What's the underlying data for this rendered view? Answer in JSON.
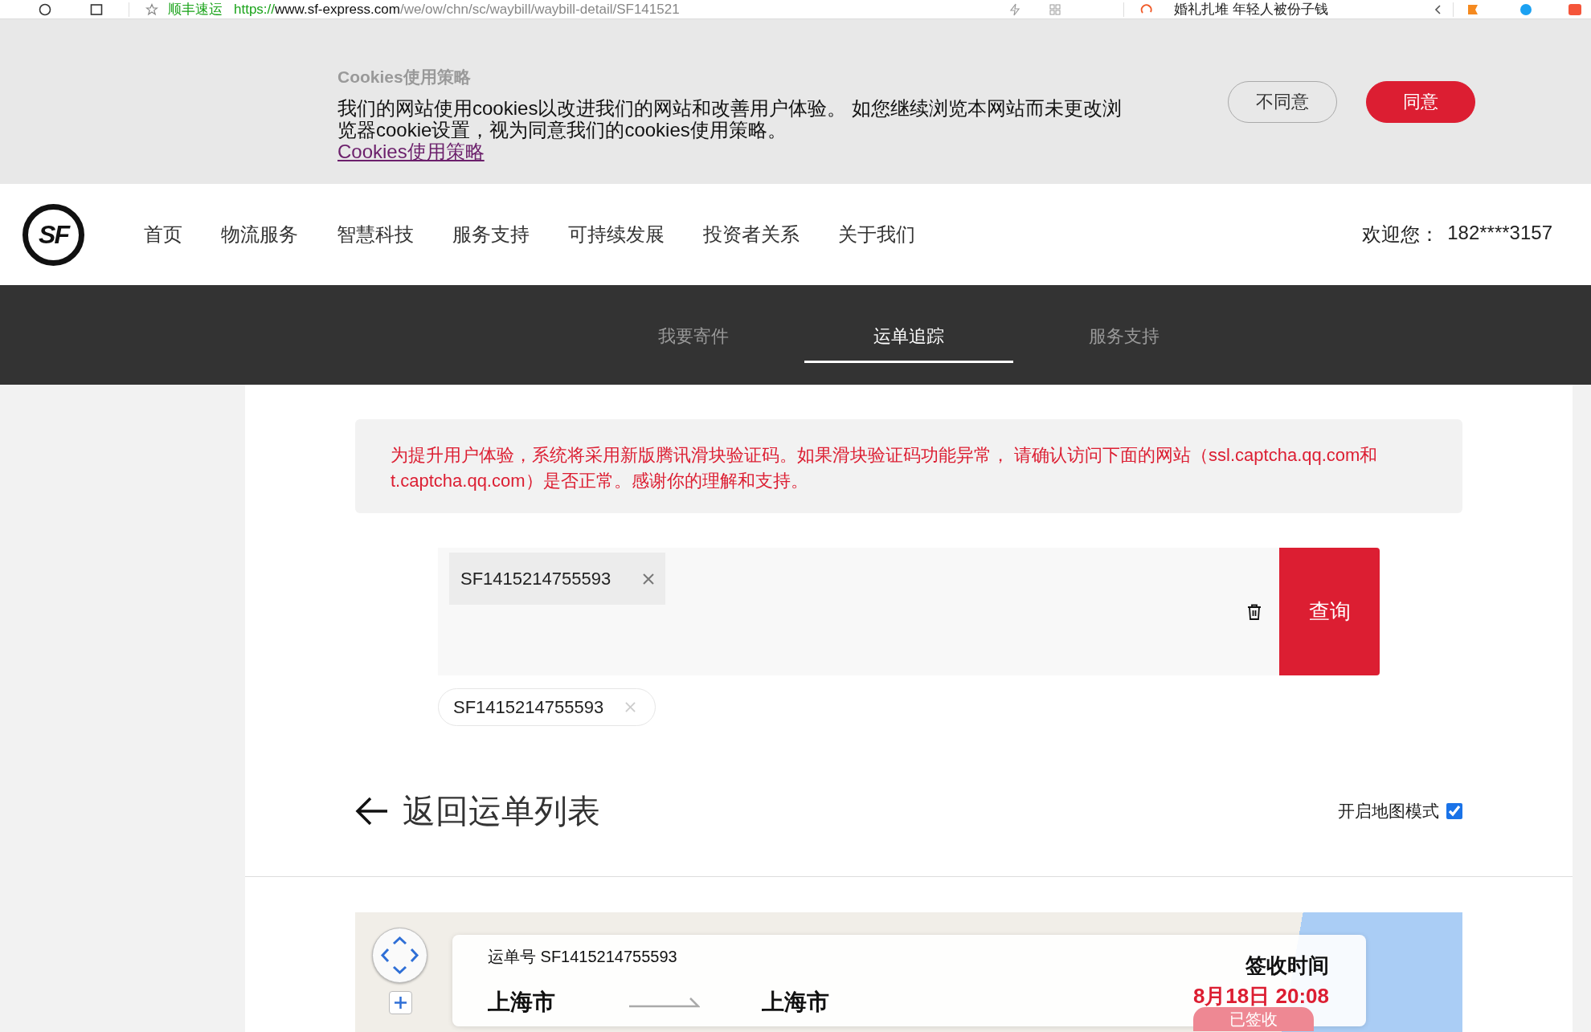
{
  "browser_bar": {
    "page_title": "顺丰速运",
    "url_scheme": "https://",
    "url_host": "www.sf-express.com",
    "url_path": "/we/ow/chn/sc/waybill/waybill-detail/SF141521",
    "news_headline": "婚礼扎堆 年轻人被份子钱"
  },
  "cookie_banner": {
    "title": "Cookies使用策略",
    "body": "我们的网站使用cookies以改进我们的网站和改善用户体验。 如您继续浏览本网站而未更改浏览器cookie设置，视为同意我们的cookies使用策略。",
    "link": "Cookies使用策略",
    "buttons": [
      {
        "label": "不同意",
        "kind": "secondary"
      },
      {
        "label": "同意",
        "kind": "primary"
      }
    ]
  },
  "header": {
    "logo": "SF",
    "nav": [
      "首页",
      "物流服务",
      "智慧科技",
      "服务支持",
      "可持续发展",
      "投资者关系",
      "关于我们"
    ],
    "welcome": "欢迎您：",
    "user": "182****3157"
  },
  "tabs": [
    {
      "label": "我要寄件",
      "selected": false
    },
    {
      "label": "运单追踪",
      "selected": true
    },
    {
      "label": "服务支持",
      "selected": false
    }
  ],
  "notice": "为提升用户体验，系统将采用新版腾讯滑块验证码。如果滑块验证码功能异常， 请确认访问下面的网站（ssl.captcha.qq.com和t.captcha.qq.com）是否正常。感谢你的理解和支持。",
  "search": {
    "tags": [
      "SF1415214755593"
    ],
    "button": "查询"
  },
  "history": [
    "SF1415214755593"
  ],
  "back_link": "返回运单列表",
  "map_mode": {
    "label": "开启地图模式",
    "checked": true
  },
  "waybill_card": {
    "waybill_number": "运单号 SF1415214755593",
    "origin": "上海市",
    "destination": "上海市",
    "time_label": "签收时间",
    "time": "8月18日 20:08",
    "status": "已签收"
  }
}
